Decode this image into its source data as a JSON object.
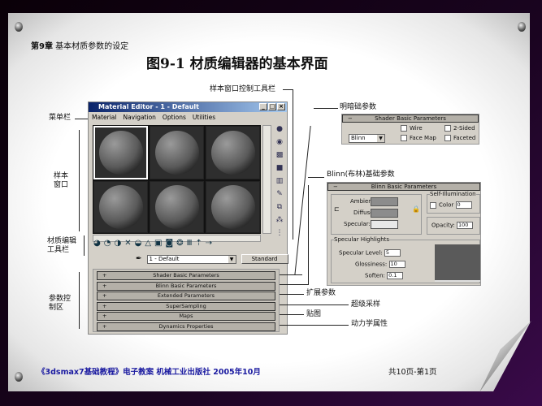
{
  "header": {
    "chapter_num": "第9章",
    "chapter_title": "基本材质参数的设定",
    "figure_title": "图9-1 材质编辑器的基本界面"
  },
  "annotations": {
    "sample_toolbar": "样本窗口控制工具栏",
    "menu_bar": "菜单栏",
    "sample_window": "样本窗口",
    "material_toolbar": "材质编辑工具栏",
    "param_area": "参数控制区",
    "shader_params": "明暗础参数",
    "blinn_params": "Blinn(布林)基础参数",
    "extended": "扩展参数",
    "supersampling": "超级采样",
    "maps": "贴图",
    "dynamics": "动力学属性"
  },
  "editor": {
    "title": "Material Editor - 1 - Default",
    "menu": [
      "Material",
      "Navigation",
      "Options",
      "Utilities"
    ],
    "material_name": "1 - Default",
    "type_button": "Standard",
    "rollouts": [
      "Shader Basic Parameters",
      "Blinn Basic Parameters",
      "Extended Parameters",
      "SuperSampling",
      "Maps",
      "Dynamics Properties"
    ]
  },
  "shader_panel": {
    "title": "Shader Basic Parameters",
    "shader": "Blinn",
    "wire": "Wire",
    "two_sided": "2-Sided",
    "face_map": "Face Map",
    "faceted": "Faceted"
  },
  "blinn_panel": {
    "title": "Blinn Basic Parameters",
    "ambient": "Ambient:",
    "diffuse": "Diffuse:",
    "specular": "Specular:",
    "self_illum": "Self-Illumination",
    "color": "Color",
    "color_val": "0",
    "opacity": "Opacity:",
    "opacity_val": "100",
    "spec_highlights": "Specular Highlights",
    "spec_level": "Specular Level:",
    "spec_level_val": "5",
    "glossiness": "Glossiness:",
    "glossiness_val": "10",
    "soften": "Soften:",
    "soften_val": "0.1"
  },
  "footer": {
    "book": "《3dsmax7基础教程》电子教案 机械工业出版社 2005年10月",
    "page": "共10页-第1页"
  },
  "colors": {
    "footer_text": "#1a1aa0",
    "title_bar": "#0a246a"
  }
}
